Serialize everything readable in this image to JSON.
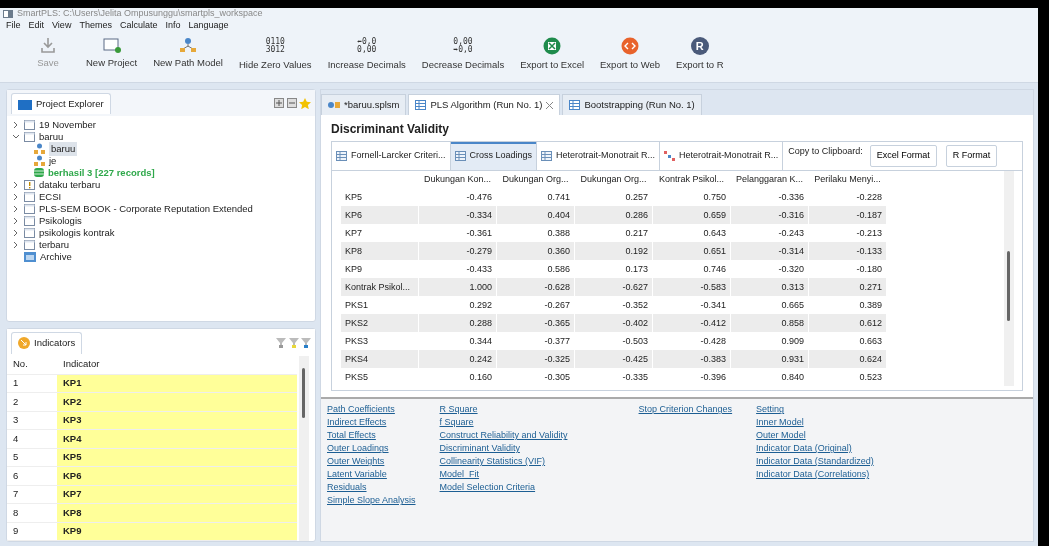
{
  "window": {
    "title": "SmartPLS: C:\\Users\\Jelita Ompusunggu\\smartpls_workspace"
  },
  "menu": [
    "File",
    "Edit",
    "View",
    "Themes",
    "Calculate",
    "Info",
    "Language"
  ],
  "toolbar": [
    {
      "kind": "save",
      "label": "Save",
      "disabled": true
    },
    {
      "kind": "project",
      "label": "New Project",
      "disabled": false
    },
    {
      "kind": "model",
      "label": "New Path Model",
      "disabled": false
    },
    {
      "kind": "digits",
      "label": "Hide Zero Values",
      "disabled": false,
      "icon_lines": [
        "0110",
        "3012"
      ]
    },
    {
      "kind": "digits",
      "label": "Increase Decimals",
      "disabled": false,
      "icon_lines": [
        "⬅0,0",
        "0,00"
      ]
    },
    {
      "kind": "digits",
      "label": "Decrease Decimals",
      "disabled": false,
      "icon_lines": [
        "0,00",
        "➡0,0"
      ]
    },
    {
      "kind": "excel",
      "label": "Export to Excel",
      "disabled": false
    },
    {
      "kind": "web",
      "label": "Export to Web",
      "disabled": false
    },
    {
      "kind": "r",
      "label": "Export to R",
      "disabled": false,
      "icon_text": "R"
    }
  ],
  "project_explorer": {
    "title": "Project Explorer",
    "tree": [
      {
        "kind": "folder",
        "label": "19 November",
        "expanded": false,
        "selected": false
      },
      {
        "kind": "folder",
        "label": "baruu",
        "expanded": true,
        "selected": false,
        "children": [
          {
            "kind": "model",
            "label": "baruu",
            "selected": true
          },
          {
            "kind": "model",
            "label": "je",
            "selected": false
          },
          {
            "kind": "data",
            "label": "berhasil 3 [227 records]",
            "selected": false
          }
        ]
      },
      {
        "kind": "warning",
        "label": "dataku terbaru",
        "expanded": false,
        "selected": false
      },
      {
        "kind": "folder",
        "label": "ECSI",
        "expanded": false,
        "selected": false
      },
      {
        "kind": "folder",
        "label": "PLS-SEM BOOK - Corporate Reputation Extended",
        "expanded": false,
        "selected": false
      },
      {
        "kind": "folder",
        "label": "Psikologis",
        "expanded": false,
        "selected": false
      },
      {
        "kind": "folder",
        "label": "psikologis kontrak",
        "expanded": false,
        "selected": false
      },
      {
        "kind": "folder",
        "label": "terbaru",
        "expanded": false,
        "selected": false
      },
      {
        "kind": "archive",
        "label": "Archive",
        "selected": false
      }
    ]
  },
  "indicators": {
    "title": "Indicators",
    "columns": [
      "No.",
      "Indicator"
    ],
    "rows": [
      [
        "1",
        "KP1"
      ],
      [
        "2",
        "KP2"
      ],
      [
        "3",
        "KP3"
      ],
      [
        "4",
        "KP4"
      ],
      [
        "5",
        "KP5"
      ],
      [
        "6",
        "KP6"
      ],
      [
        "7",
        "KP7"
      ],
      [
        "8",
        "KP8"
      ],
      [
        "9",
        "KP9"
      ]
    ]
  },
  "editor_tabs": [
    {
      "kind": "model",
      "label": "*baruu.splsm",
      "selected": false,
      "closable": false
    },
    {
      "kind": "table",
      "label": "PLS Algorithm (Run No. 1)",
      "selected": true,
      "closable": true
    },
    {
      "kind": "table",
      "label": "Bootstrapping (Run No. 1)",
      "selected": false,
      "closable": false
    }
  ],
  "report": {
    "title": "Discriminant Validity",
    "tabs": [
      {
        "kind": "table",
        "label": "Fornell-Larcker Criteri...",
        "selected": false
      },
      {
        "kind": "table",
        "label": "Cross Loadings",
        "selected": true
      },
      {
        "kind": "table",
        "label": "Heterotrait-Monotrait R...",
        "selected": false
      },
      {
        "kind": "matrix",
        "label": "Heterotrait-Monotrait R...",
        "selected": false
      }
    ],
    "clipboard_label": "Copy to Clipboard:",
    "clipboard_buttons": [
      "Excel Format",
      "R Format"
    ],
    "table": {
      "columns": [
        "",
        "Dukungan Kon...",
        "Dukungan Org...",
        "Dukungan Org...",
        "Kontrak Psikol...",
        "Pelanggaran K...",
        "Perilaku Menyi..."
      ],
      "rows": [
        [
          "KP5",
          "-0.476",
          "0.741",
          "0.257",
          "0.750",
          "-0.336",
          "-0.228"
        ],
        [
          "KP6",
          "-0.334",
          "0.404",
          "0.286",
          "0.659",
          "-0.316",
          "-0.187"
        ],
        [
          "KP7",
          "-0.361",
          "0.388",
          "0.217",
          "0.643",
          "-0.243",
          "-0.213"
        ],
        [
          "KP8",
          "-0.279",
          "0.360",
          "0.192",
          "0.651",
          "-0.314",
          "-0.133"
        ],
        [
          "KP9",
          "-0.433",
          "0.586",
          "0.173",
          "0.746",
          "-0.320",
          "-0.180"
        ],
        [
          "Kontrak Psikol...",
          "1.000",
          "-0.628",
          "-0.627",
          "-0.583",
          "0.313",
          "0.271"
        ],
        [
          "PKS1",
          "0.292",
          "-0.267",
          "-0.352",
          "-0.341",
          "0.665",
          "0.389"
        ],
        [
          "PKS2",
          "0.288",
          "-0.365",
          "-0.402",
          "-0.412",
          "0.858",
          "0.612"
        ],
        [
          "PKS3",
          "0.344",
          "-0.377",
          "-0.503",
          "-0.428",
          "0.909",
          "0.663"
        ],
        [
          "PKS4",
          "0.242",
          "-0.325",
          "-0.425",
          "-0.383",
          "0.931",
          "0.624"
        ],
        [
          "PKS5",
          "0.160",
          "-0.305",
          "-0.335",
          "-0.396",
          "0.840",
          "0.523"
        ]
      ]
    }
  },
  "report_links": [
    [
      "Path Coefficients",
      "Indirect Effects",
      "Total Effects",
      "Outer Loadings",
      "Outer Weights",
      "Latent Variable",
      "Residuals",
      "Simple Slope Analysis"
    ],
    [
      "R Square",
      "f Square",
      "Construct Reliability and Validity",
      "Discriminant Validity",
      "Collinearity Statistics (VIF)",
      "Model_Fit",
      "Model Selection Criteria"
    ],
    [
      "Stop Criterion Changes"
    ],
    [
      "Setting",
      "Inner Model",
      "Outer Model",
      "Indicator Data (Original)",
      "Indicator Data (Standardized)",
      "Indicator Data (Correlations)"
    ]
  ]
}
